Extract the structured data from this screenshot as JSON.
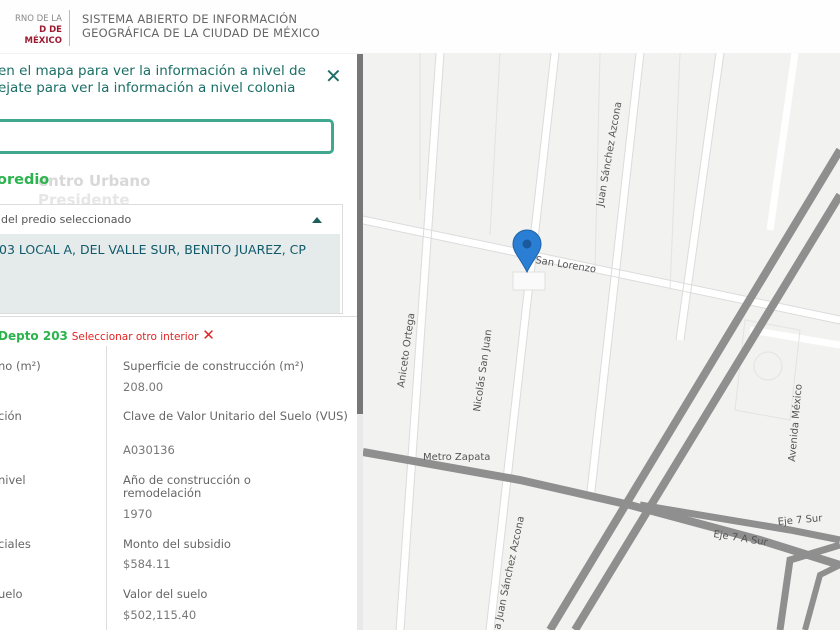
{
  "header": {
    "gov_logo_line1": "RNO DE LA",
    "gov_logo_line2": "D DE MÉXICO",
    "title_line1": "SISTEMA ABIERTO DE INFORMACIÓN",
    "title_line2": "GEOGRÁFICA DE LA CIUDAD DE MÉXICO"
  },
  "panel": {
    "instruction_line1": "en el mapa para ver la información a nivel de",
    "instruction_line2": "ejate para ver la información a nivel colonia",
    "search_value": "",
    "section_title": "oredio",
    "ghost_line1": "entro Urbano",
    "ghost_line2": "Presidente",
    "accordion_label": "del predio seleccionado",
    "address": "03 LOCAL A, DEL VALLE SUR, BENITO JUAREZ, CP",
    "interior_label": "Depto 203",
    "interior_link": "Seleccionar otro interior",
    "interior_remove": "✕"
  },
  "fields_left": [
    {
      "label": "no (m²)"
    },
    {
      "label": "ción"
    },
    {
      "label": "nivel"
    },
    {
      "label": "ciales"
    },
    {
      "label": "uelo"
    }
  ],
  "fields_right": [
    {
      "label": "Superficie de construcción (m²)",
      "value": "208.00"
    },
    {
      "label": "Clave de Valor Unitario del Suelo (VUS)",
      "value": "A030136"
    },
    {
      "label": "Año de construcción o remodelación",
      "value": "1970"
    },
    {
      "label": "Monto del subsidio",
      "value": "$584.11"
    },
    {
      "label": "Valor del suelo",
      "value": "$502,115.40"
    }
  ],
  "map": {
    "labels": {
      "san_lorenzo": "San Lorenzo",
      "juan_sanchez_azcona_top": "Juan Sánchez Azcona",
      "juan_sanchez_azcona_bottom": "a Juan Sánchez Azcona",
      "aniceto_ortega": "Aniceto Ortega",
      "nicolas_san_juan": "Nicolás San Juan",
      "metro_zapata": "Metro Zapata",
      "avenida_mexico": "Avenida México",
      "eje7_sur_a": "Eje 7 Sur",
      "eje7_sur_b": "Eje 7 A Sur"
    },
    "marker_color": "#2a7fd4"
  }
}
